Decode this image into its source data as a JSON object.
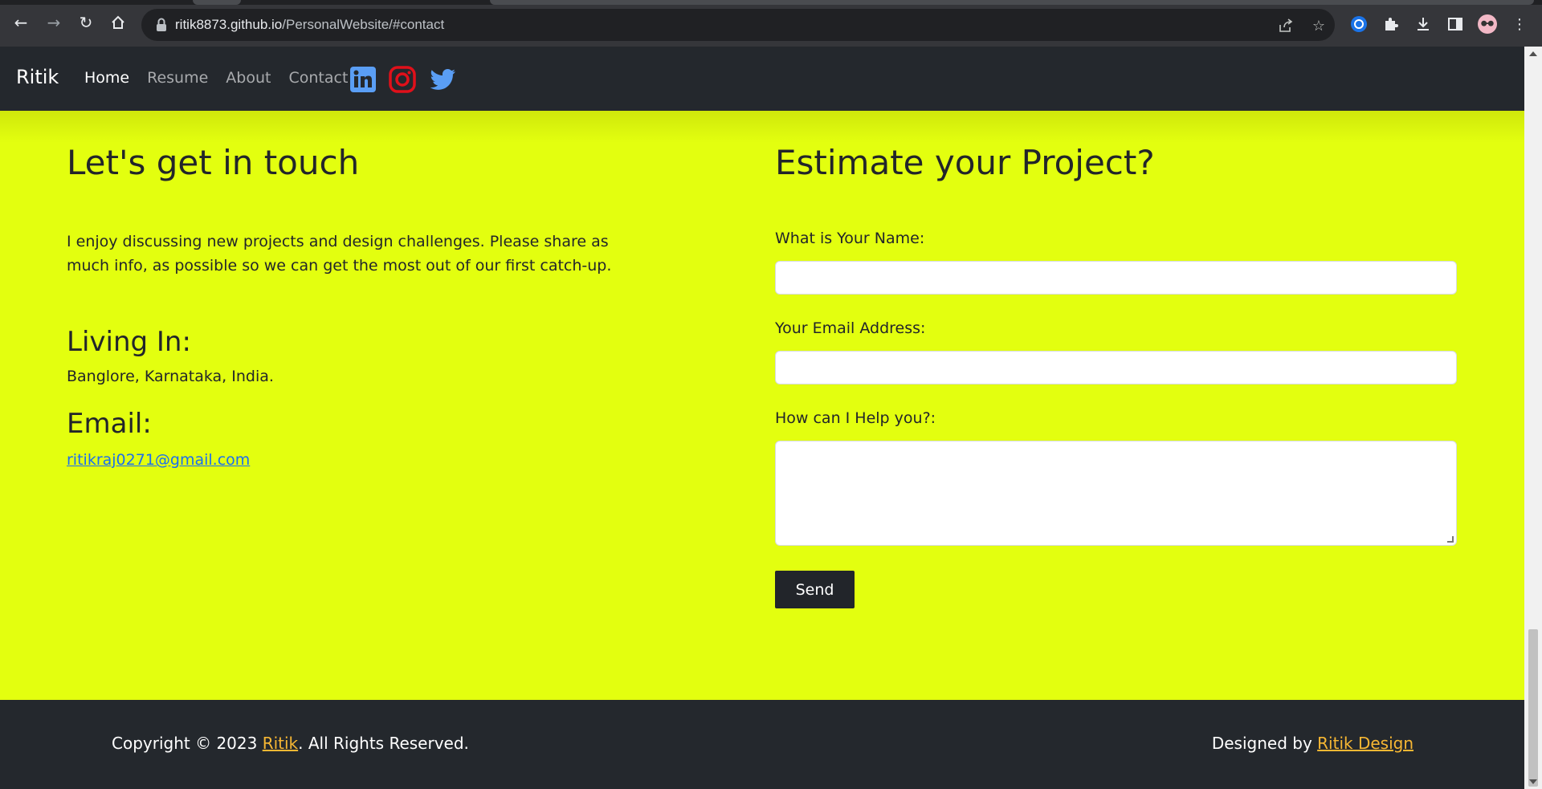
{
  "browser": {
    "url_host": "ritik8873.github.io",
    "url_path": "/PersonalWebsite/#contact"
  },
  "nav": {
    "brand": "Ritik",
    "items": [
      {
        "label": "Home",
        "active": true
      },
      {
        "label": "Resume",
        "active": false
      },
      {
        "label": "About",
        "active": false
      },
      {
        "label": "Contact",
        "active": false
      }
    ],
    "social_icons": [
      "linkedin-icon",
      "instagram-icon",
      "twitter-icon"
    ]
  },
  "contact": {
    "heading": "Let's get in touch",
    "intro": "I enjoy discussing new projects and design challenges. Please share as much info, as possible so we can get the most out of our first catch-up.",
    "living_heading": "Living In:",
    "living_value": "Banglore, Karnataka, India.",
    "email_heading": "Email:",
    "email_value": "ritikraj0271@gmail.com"
  },
  "form": {
    "heading": "Estimate your Project?",
    "name_label": "What is Your Name:",
    "name_value": "",
    "email_label": "Your Email Address:",
    "email_value": "",
    "help_label": "How can I Help you?:",
    "help_value": "",
    "send_label": "Send"
  },
  "footer": {
    "copy_prefix": "Copyright © 2023 ",
    "copy_link": "Ritik",
    "copy_suffix": ". All Rights Reserved.",
    "designed_prefix": "Designed by ",
    "designed_link": "Ritik Design"
  },
  "colors": {
    "page_bg": "#e3ff0f",
    "nav_bg": "#24282d",
    "link_footer": "#f7b733",
    "email_link": "#1a6ef0",
    "linkedin": "#5a9ef5",
    "instagram": "#e0101a",
    "twitter": "#5a9ef5"
  }
}
